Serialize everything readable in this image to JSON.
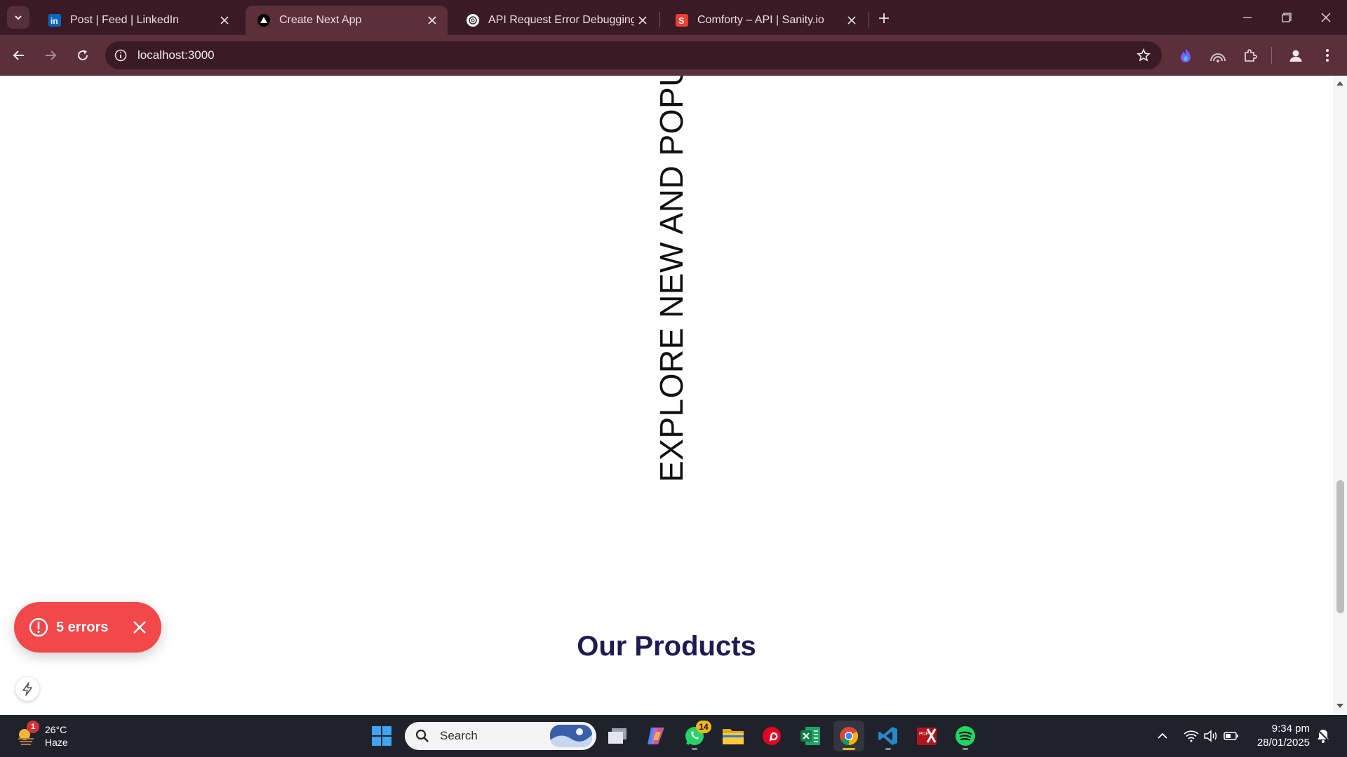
{
  "browser": {
    "tabs": [
      {
        "title": "Post | Feed | LinkedIn",
        "favicon": "linkedin-icon",
        "active": false
      },
      {
        "title": "Create Next App",
        "favicon": "nextjs-triangle-icon",
        "active": true
      },
      {
        "title": "API Request Error Debugging",
        "favicon": "chatgpt-icon",
        "active": false
      },
      {
        "title": "Comforty – API | Sanity.io",
        "favicon": "sanity-icon",
        "active": false
      }
    ],
    "url": "localhost:3000"
  },
  "page": {
    "vertical_heading": "EXPLORE NEW AND POPULA",
    "products_title": "Our Products",
    "errors_label": "5 errors"
  },
  "taskbar": {
    "weather_temp": "26°C",
    "weather_desc": "Haze",
    "weather_badge": "1",
    "search_placeholder": "Search",
    "whatsapp_badge": "14",
    "time": "9:34 pm",
    "date": "28/01/2025"
  },
  "colors": {
    "tab_strip": "#3a1b25",
    "toolbar": "#5b2f3c",
    "error_pill": "#f2484a",
    "products_title": "#1f1b52"
  }
}
